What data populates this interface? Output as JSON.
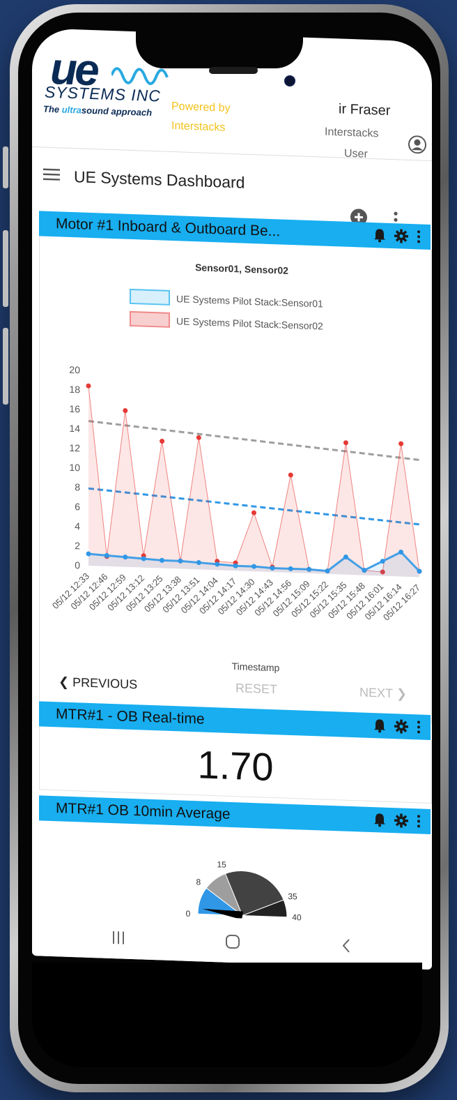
{
  "header": {
    "logo_mark": "ue",
    "logo_company": "SYSTEMS INC",
    "logo_tagline_pre": "The ",
    "logo_tagline_hl": "ultra",
    "logo_tagline_post": "sound approach",
    "powered_line1": "Powered by",
    "powered_line2": "Interstacks",
    "user_name": "ir Fraser",
    "user_org": "Interstacks",
    "user_role": "User"
  },
  "titlebar": {
    "title": "UE Systems Dashboard"
  },
  "widgets": [
    {
      "title": "Motor #1 Inboard & Outboard Be..."
    },
    {
      "title": "MTR#1 - OB Real-time",
      "value": "1.70"
    },
    {
      "title": "MTR#1 OB 10min Average"
    }
  ],
  "chart_nav": {
    "previous": "PREVIOUS",
    "reset": "RESET",
    "next": "NEXT"
  },
  "chart_data": {
    "type": "line",
    "title": "Sensor01, Sensor02",
    "xlabel": "Timestamp",
    "ylabel": "",
    "ylim": [
      0,
      20
    ],
    "yticks": [
      0,
      2,
      4,
      6,
      8,
      10,
      12,
      14,
      16,
      18,
      20
    ],
    "categories": [
      "05/12 12:33",
      "05/12 12:46",
      "05/12 12:59",
      "05/12 13:12",
      "05/12 13:25",
      "05/12 13:38",
      "05/12 13:51",
      "05/12 14:04",
      "05/12 14:17",
      "05/12 14:30",
      "05/12 14:43",
      "05/12 14:56",
      "05/12 15:09",
      "05/12 15:22",
      "05/12 15:35",
      "05/12 15:48",
      "05/12 16:01",
      "05/12 16:14",
      "05/12 16:27"
    ],
    "colors": {
      "sensor01": "#2f97e6",
      "sensor02": "#e53935",
      "threshold_high": "#9e9e9e",
      "threshold_low": "#2f97e6"
    },
    "series": [
      {
        "name": "UE Systems Pilot Stack:Sensor01",
        "values": [
          1.2,
          1.1,
          1.0,
          0.9,
          0.8,
          0.8,
          0.7,
          0.6,
          0.5,
          0.5,
          0.4,
          0.4,
          0.4,
          0.3,
          1.8,
          0.5,
          1.5,
          2.5,
          0.6
        ]
      },
      {
        "name": "UE Systems Pilot Stack:Sensor02",
        "values": [
          18.4,
          1.0,
          16.0,
          1.2,
          13.0,
          0.8,
          13.5,
          0.9,
          0.8,
          6.0,
          0.5,
          10.0,
          0.4,
          0.3,
          13.5,
          0.5,
          0.4,
          13.6,
          0.6
        ]
      }
    ],
    "thresholds": [
      {
        "start": 14.8,
        "end": 12.0
      },
      {
        "start": 7.9,
        "end": 5.4
      }
    ]
  },
  "gauge": {
    "ticks": [
      "0",
      "8",
      "15",
      "35",
      "40"
    ],
    "value": 1.7,
    "min": 0,
    "max": 40
  }
}
